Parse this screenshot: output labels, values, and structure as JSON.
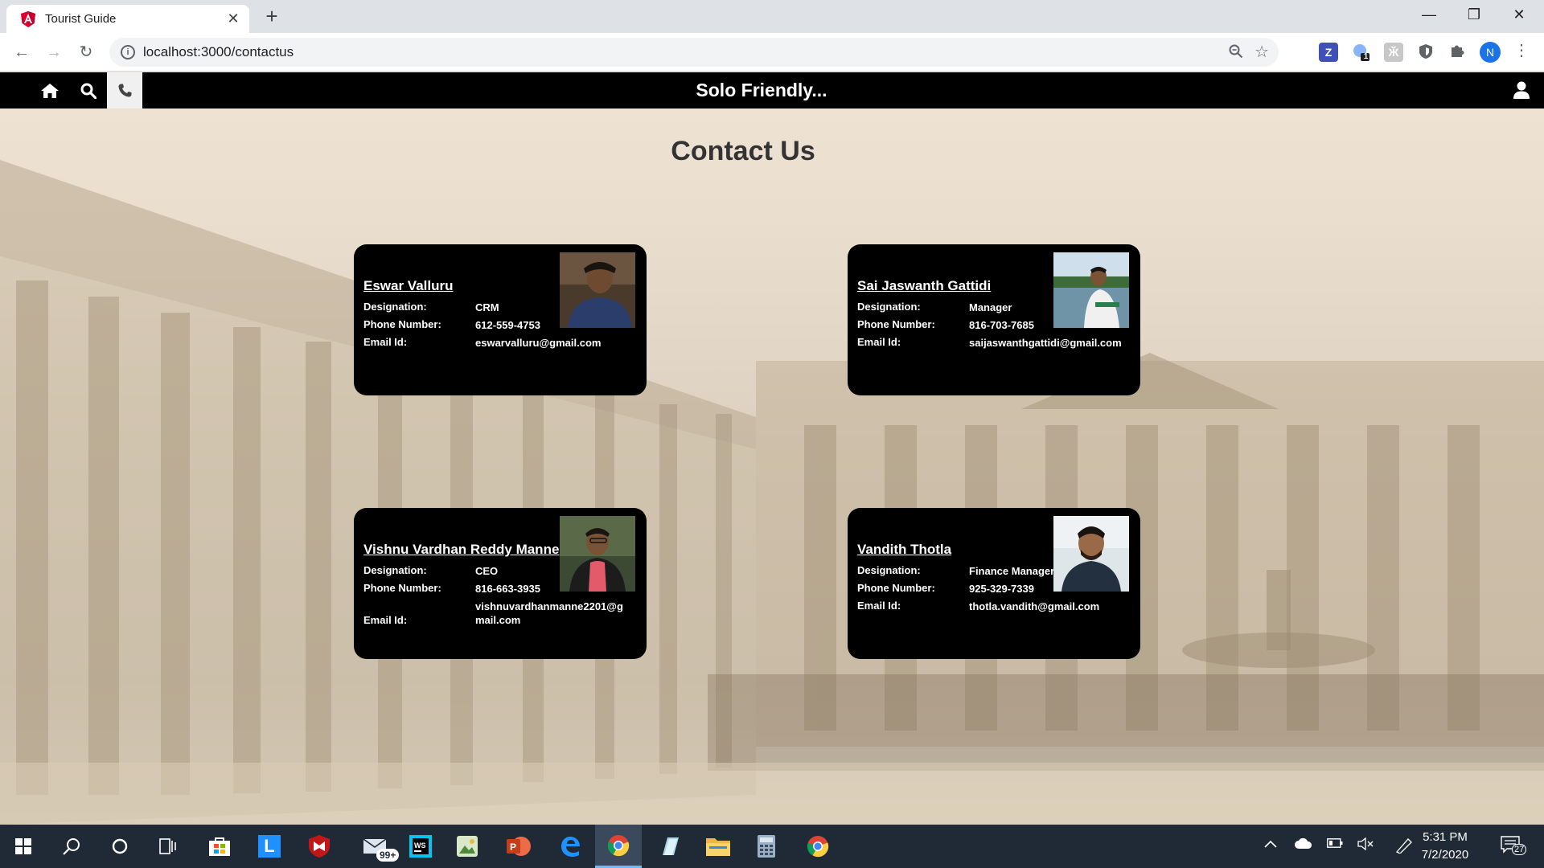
{
  "browser": {
    "tab_title": "Tourist Guide",
    "url": "localhost:3000/contactus",
    "profile_initial": "N",
    "extension_badge": "1",
    "favicon": "angular-icon"
  },
  "app": {
    "brand": "Solo Friendly...",
    "nav": [
      {
        "name": "home-icon"
      },
      {
        "name": "search-icon"
      },
      {
        "name": "phone-icon",
        "active": true
      }
    ]
  },
  "page": {
    "title": "Contact Us"
  },
  "contacts": [
    {
      "name": "Eswar Valluru",
      "designation_label": "Designation:",
      "designation": "CRM",
      "phone_label": "Phone Number:",
      "phone": "612-559-4753",
      "email_label": "Email Id:",
      "email": "eswarvalluru@gmail.com"
    },
    {
      "name": "Sai Jaswanth Gattidi",
      "designation_label": "Designation:",
      "designation": "Manager",
      "phone_label": "Phone Number:",
      "phone": "816-703-7685",
      "email_label": "Email Id:",
      "email": "saijaswanthgattidi@gmail.com"
    },
    {
      "name": "Vishnu Vardhan Reddy Manne",
      "designation_label": "Designation:",
      "designation": "CEO",
      "phone_label": "Phone Number:",
      "phone": "816-663-3935",
      "email_label": "Email Id:",
      "email": "vishnuvardhanmanne2201@gmail.com"
    },
    {
      "name": "Vandith Thotla",
      "designation_label": "Designation:",
      "designation": "Finance Manager",
      "phone_label": "Phone Number:",
      "phone": "925-329-7339",
      "email_label": "Email Id:",
      "email": "thotla.vandith@gmail.com"
    }
  ],
  "taskbar": {
    "mail_badge": "99+",
    "clock_time": "5:31 PM",
    "clock_date": "7/2/2020",
    "notifications": "27"
  }
}
